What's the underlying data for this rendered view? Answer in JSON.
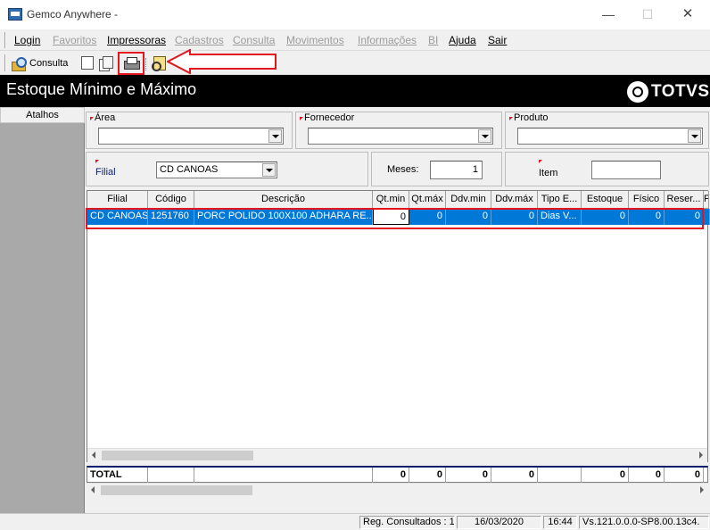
{
  "window": {
    "title": "Gemco Anywhere -",
    "minimize_glyph": "—",
    "maximize_glyph": "☐",
    "close_glyph": "✕"
  },
  "menu": {
    "items": [
      {
        "label": "Login",
        "enabled": true
      },
      {
        "label": "Favoritos",
        "enabled": false
      },
      {
        "label": "Impressoras",
        "enabled": true
      },
      {
        "label": "Cadastros",
        "enabled": false
      },
      {
        "label": "Consulta",
        "enabled": false
      },
      {
        "label": "Movimentos",
        "enabled": false
      },
      {
        "label": "Informações",
        "enabled": false
      },
      {
        "label": "BI",
        "enabled": false
      },
      {
        "label": "Ajuda",
        "enabled": true
      },
      {
        "label": "Sair",
        "enabled": true
      }
    ]
  },
  "toolbar": {
    "consulta_label": "Consulta",
    "icons": [
      "consulta-icon",
      "new-document-icon",
      "copy-document-icon",
      "printer-icon",
      "report-search-icon"
    ],
    "highlight_color": "#e2161c"
  },
  "header": {
    "title": "Estoque Mínimo e Máximo",
    "logo_text": "TOTVS"
  },
  "sidebar": {
    "header": "Atalhos"
  },
  "filters": {
    "area_label": "Área",
    "area_value": "",
    "fornecedor_label": "Fornecedor",
    "fornecedor_value": "",
    "produto_label": "Produto",
    "produto_value": "",
    "filial_label": "Filial",
    "filial_value": "CD CANOAS",
    "meses_label": "Meses:",
    "meses_value": "1",
    "item_label": "Item",
    "item_value": ""
  },
  "grid": {
    "columns": [
      "Filial",
      "Código",
      "Descrição",
      "Qt.min",
      "Qt.máx",
      "Ddv.min",
      "Ddv.máx",
      "Tipo E...",
      "Estoque",
      "Físico",
      "Reser...",
      "F"
    ],
    "rows": [
      [
        "CD CANOAS",
        "1251760",
        "PORC POLIDO 100X100 ADHARA RE...",
        "0",
        "0",
        "0",
        "0",
        "Dias V...",
        "0",
        "0",
        "0",
        ""
      ]
    ],
    "selected_color": "#0078d7"
  },
  "totals": {
    "label": "TOTAL",
    "values": [
      "0",
      "0",
      "0",
      "0",
      "0",
      "0",
      "0"
    ]
  },
  "status": {
    "reg_consultados": "Reg. Consultados : 1",
    "date": "16/03/2020",
    "time": "16:44",
    "version": "Vs.121.0.0.0-SP8.00.13c4."
  }
}
